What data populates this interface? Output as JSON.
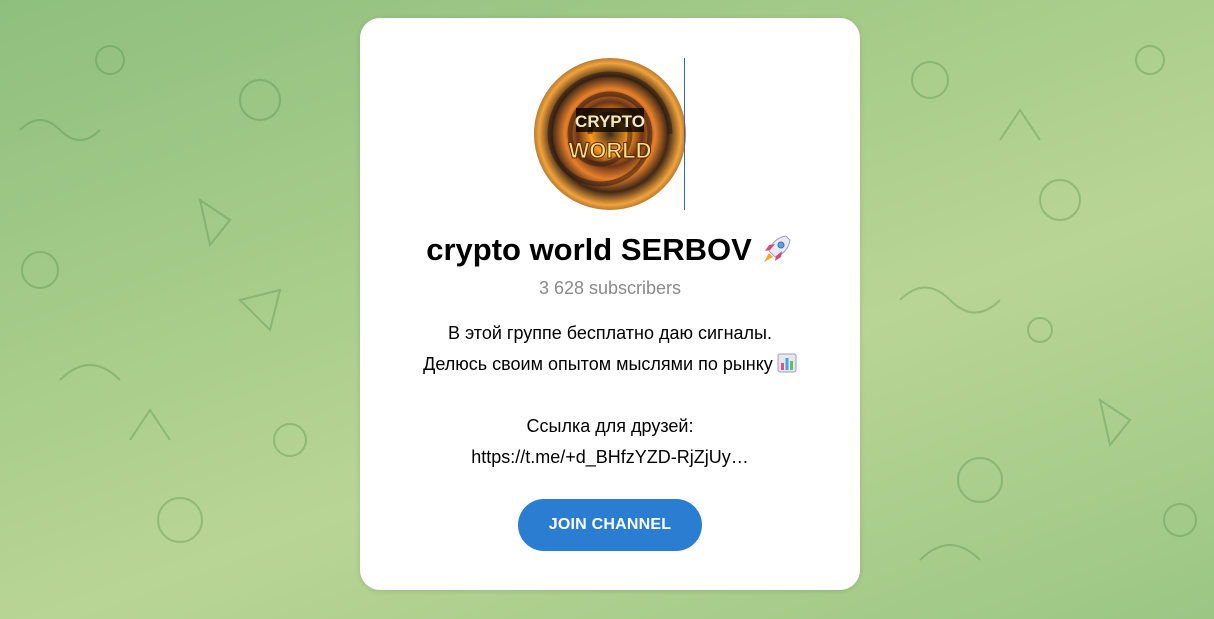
{
  "channel": {
    "title": "crypto world SERBOV",
    "subscribers": "3 628 subscribers",
    "avatar_text_line1": "CRYPTO",
    "avatar_text_line2": "WORLD",
    "description": [
      "В этой группе бесплатно даю сигналы.",
      "Делюсь своим опытом мыслями по рынку",
      "",
      "Ссылка для друзей:",
      "https://t.me/+d_BHfzYZD-RjZjUy…"
    ],
    "join_label": "JOIN CHANNEL"
  },
  "icons": {
    "title_emoji": "rocket-icon",
    "description_emoji": "bar-chart-icon"
  },
  "colors": {
    "accent": "#2a7dd1",
    "muted_text": "#8a8a8a"
  }
}
